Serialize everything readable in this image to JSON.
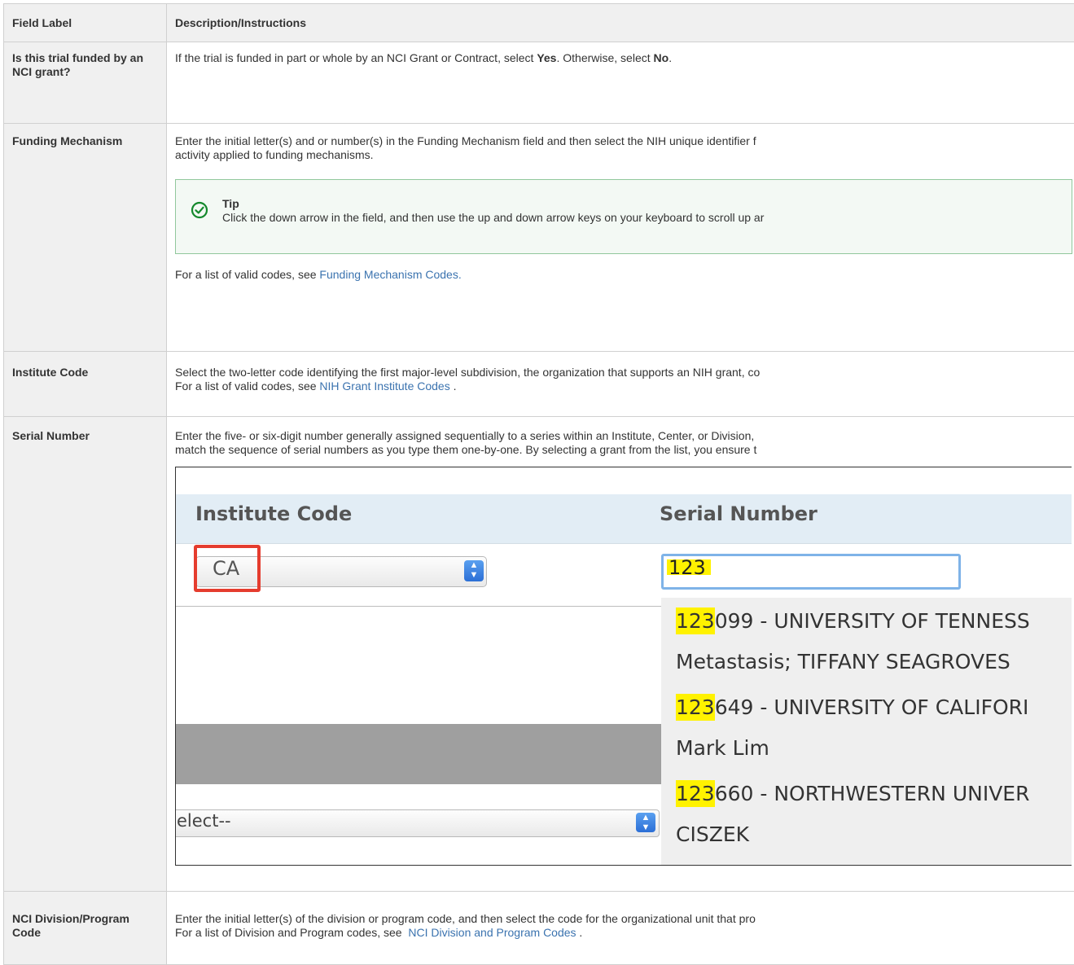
{
  "table": {
    "headers": [
      "Field Label",
      "Description/Instructions"
    ],
    "rows": [
      {
        "label": "Is this trial funded by an NCI grant?",
        "text_pre": "If the trial is funded in part or whole by an NCI Grant or Contract, select ",
        "bold1": "Yes",
        "text_mid": ". Otherwise, select ",
        "bold2": "No",
        "text_post": "."
      },
      {
        "label": "Funding Mechanism",
        "line1": "Enter the initial letter(s) and or number(s) in the Funding Mechanism field and then select the NIH unique identifier f",
        "line2": "activity applied to funding mechanisms.",
        "tip_title": "Tip",
        "tip_body": "Click the down arrow in the field, and then use the up and down arrow keys on your keyboard to scroll up ar",
        "codes_pre": "For a list of valid codes, see ",
        "codes_link": "Funding Mechanism Codes."
      },
      {
        "label": "Institute Code",
        "line1": "Select the two-letter code identifying the first major-level subdivision, the organization that supports an NIH grant, co",
        "line2_pre": "For a list of valid codes, see ",
        "line2_link": "NIH Grant Institute Codes",
        "line2_post": " ."
      },
      {
        "label": "Serial Number",
        "line1": "Enter the five- or six-digit number generally assigned sequentially to a series within an Institute, Center, or Division,",
        "line2": "match the sequence of serial numbers as you type them one-by-one. By selecting a grant from the list, you ensure t"
      },
      {
        "label": "NCI Division/Program Code",
        "line1": "Enter the initial letter(s) of the division or program code, and then select the code for the organizational unit that pro",
        "line2_pre": "For a list of Division and Program codes, see  ",
        "line2_link": "NCI Division and Program Codes",
        "line2_post": " ."
      }
    ]
  },
  "screenshot": {
    "institute_header": "Institute Code",
    "serial_header": "Serial Number",
    "institute_value": "CA",
    "serial_value": "123",
    "lower_select": "elect--",
    "suggestions": [
      {
        "prefix": "123",
        "line1_rest": "099 - UNIVERSITY OF TENNESS",
        "line2": "Metastasis; TIFFANY SEAGROVES"
      },
      {
        "prefix": "123",
        "line1_rest": "649 - UNIVERSITY OF CALIFORI",
        "line2": "Mark Lim"
      },
      {
        "prefix": "123",
        "line1_rest": "660 - NORTHWESTERN UNIVER",
        "line2": "CISZEK"
      }
    ]
  },
  "colors": {
    "link": "#3b73af",
    "tip_border": "#91c89c",
    "highlight": "#fff200",
    "red_box": "#e53c2e"
  }
}
